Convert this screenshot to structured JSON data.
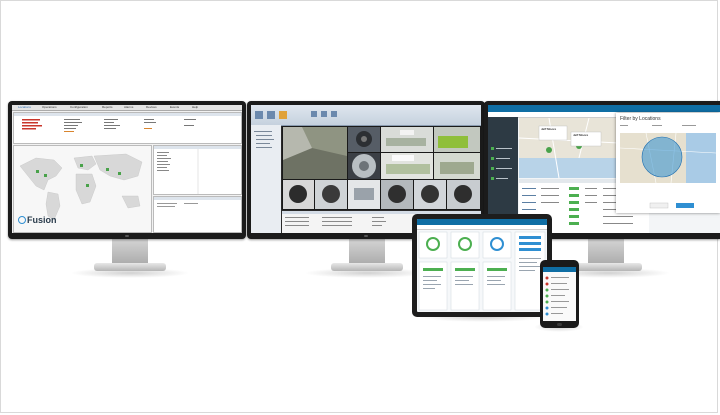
{
  "image": {
    "monitor_left": {
      "tabs": [
        "Locations",
        "Operations",
        "Configuration",
        "Reports",
        "Alarms",
        "Devices",
        "Events",
        "Help"
      ],
      "brand": "Fusion",
      "brand_tag": "by ..."
    },
    "monitor_right": {
      "dialog_title": "Filter by Locations",
      "popup_label_1": "Jeff Moore",
      "popup_label_2": "Jeff Moore"
    },
    "colors": {
      "bezel": "#1b1b1b",
      "accent_blue": "#2f8fd2",
      "app_header": "#0f6ea4",
      "status_green": "#4caf50",
      "map_land": "#d8d8d8",
      "map_sea": "#f5f5f5"
    }
  }
}
